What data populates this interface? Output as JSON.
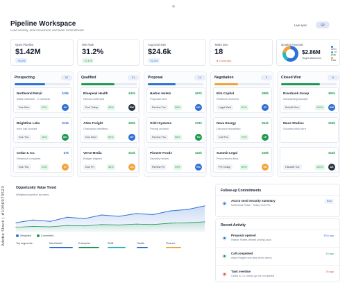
{
  "watermark": "Adobe Stock | #1956973523",
  "header": {
    "title": "Pipeline Workspace",
    "subtitle": "Lead velocity, deal movement, and team commitments",
    "live_label": "Live sync",
    "toggle_label": "Q2"
  },
  "kpis": [
    {
      "label": "Open Pipeline",
      "value": "$1.42M",
      "change": "+8.4%"
    },
    {
      "label": "Win Rate",
      "value": "31.2%",
      "change": "+2.1%"
    },
    {
      "label": "Avg Deal Size",
      "value": "$24.6k",
      "change": "+6.3%"
    },
    {
      "label": "Tasks Due",
      "value": "18",
      "change": "4 overdue"
    }
  ],
  "forecast": {
    "label": "Quarter Forecast",
    "value": "$2.86M",
    "target": "Target attainment",
    "legend": [
      "Won",
      "In play",
      "Risk"
    ],
    "colors": [
      "#2f6fd6",
      "#25b6c9",
      "#f2a33a"
    ]
  },
  "columns": [
    {
      "name": "Prospecting",
      "count": "52",
      "color": "#2f6fd6",
      "fill": 0.55,
      "cards": [
        {
          "name": "Northwind Retail",
          "amount": "$18k",
          "note": "Initial outreach · 2 contacts",
          "due": "Due Mon",
          "prob": "22%",
          "initials": "AV",
          "avatar": "#2f6fd6"
        },
        {
          "name": "Brightline Labs",
          "amount": "$11k",
          "note": "Intro call booked",
          "due": "Due Thu",
          "prob": "18%",
          "initials": "MK",
          "avatar": "#1e9a50"
        },
        {
          "name": "Cedar & Co.",
          "amount": "$7k",
          "note": "Research complete",
          "due": "Due Thu",
          "prob": "14%",
          "initials": "JT",
          "avatar": "#f2a33a"
        }
      ]
    },
    {
      "name": "Qualified",
      "count": "21",
      "color": "#1e9a50",
      "fill": 0.6,
      "cards": [
        {
          "name": "Bluepeak Health",
          "amount": "$42k",
          "note": "Needs confirmed",
          "due": "Due Today",
          "prob": "48%",
          "initials": "RW",
          "avatar": "#2a3344"
        },
        {
          "name": "Atlas Freight",
          "amount": "$29k",
          "note": "Champion identified",
          "due": "Due Wed",
          "prob": "52%",
          "initials": "DP",
          "avatar": "#2f6fd6"
        },
        {
          "name": "Verve Media",
          "amount": "$16k",
          "note": "Budget aligned",
          "due": "Due Fri",
          "prob": "45%",
          "initials": "CG",
          "avatar": "#f2a33a"
        }
      ]
    },
    {
      "name": "Proposal",
      "count": "14",
      "color": "#2f6fd6",
      "fill": 0.5,
      "cards": [
        {
          "name": "Harbor Hotels",
          "amount": "$67k",
          "note": "Proposal sent",
          "due": "Review Tue",
          "prob": "68%",
          "initials": "NO",
          "avatar": "#2f6fd6"
        },
        {
          "name": "Orbit Systems",
          "amount": "$31k",
          "note": "Pricing revision",
          "due": "Review Thu",
          "prob": "56%",
          "initials": "TW",
          "avatar": "#1e9a50"
        },
        {
          "name": "Pioneer Foods",
          "amount": "$22k",
          "note": "Security review",
          "due": "Review Fri",
          "prob": "49%",
          "initials": "EM",
          "avatar": "#2f6fd6"
        }
      ]
    },
    {
      "name": "Negotiation",
      "count": "9",
      "color": "#f2a33a",
      "fill": 0.42,
      "cards": [
        {
          "name": "Elm Capital",
          "amount": "$88k",
          "note": "Redlines received",
          "due": "Legal Wed",
          "prob": "81%",
          "initials": "IR",
          "avatar": "#2f6fd6"
        },
        {
          "name": "Nova Energy",
          "amount": "$54k",
          "note": "Discount requested",
          "due": "Call Thu",
          "prob": "74%",
          "initials": "LP",
          "avatar": "#1e9a50"
        },
        {
          "name": "Summit Legal",
          "amount": "$36k",
          "note": "Procurement final",
          "due": "PO Today",
          "prob": "69%",
          "initials": "SN",
          "avatar": "#f2a33a"
        }
      ]
    },
    {
      "name": "Closed Won",
      "count": "6",
      "color": "#1e9a50",
      "fill": 0.7,
      "cards": [
        {
          "name": "Riverbank Group",
          "amount": "$92k",
          "note": "Onboarding handoff",
          "due": "Kickoff Mon",
          "prob": "100%",
          "initials": "AW",
          "avatar": "#2f6fd6"
        },
        {
          "name": "Muse Studios",
          "amount": "$18k",
          "note": "Success intro sent",
          "due": "",
          "prob": "",
          "initials": "",
          "avatar": "#1e9a50"
        },
        {
          "name": "",
          "amount": "$16k",
          "note": "",
          "due": "Handoff Tue",
          "prob": "100%",
          "initials": "AS",
          "avatar": "#2a3344"
        }
      ]
    }
  ],
  "trend": {
    "title": "Opportunity Value Trend",
    "subtitle": "Weighted pipeline by week",
    "legend": [
      "Weighted",
      "Committed"
    ],
    "segments_label": "Top segments",
    "segments": [
      {
        "name": "Mid-Market",
        "color": "#2f6fd6"
      },
      {
        "name": "Enterprise",
        "color": "#1e9a50"
      },
      {
        "name": "SMB",
        "color": "#25b6c9"
      },
      {
        "name": "Health",
        "color": "#2f6fd6"
      },
      {
        "name": "Finance",
        "color": "#f2a33a"
      }
    ]
  },
  "chart_data": {
    "type": "area",
    "x": [
      1,
      2,
      3,
      4,
      5,
      6,
      7,
      8,
      9,
      10,
      11,
      12
    ],
    "series": [
      {
        "name": "Weighted",
        "values": [
          18,
          24,
          21,
          30,
          27,
          35,
          32,
          38,
          36,
          44,
          47,
          55
        ],
        "color": "#2f6fd6"
      },
      {
        "name": "Committed",
        "values": [
          8,
          10,
          9,
          12,
          11,
          14,
          13,
          15,
          14,
          17,
          18,
          20
        ],
        "color": "#1e9a50"
      }
    ],
    "ylim": [
      0,
      70
    ],
    "title": "Opportunity Value Trend",
    "grid": false
  },
  "commitments": {
    "title": "Follow-up Commitments",
    "items": [
      {
        "title": "Ava to send security summary",
        "sub": "Northwind Retail · Today 3:00 PM",
        "chip": "Now"
      }
    ]
  },
  "activity": {
    "title": "Recent Activity",
    "items": [
      {
        "title": "Proposal opened",
        "sub": "Harbor Hotels viewed pricing pack",
        "time": "32m ago",
        "color": "#2f6fd6"
      },
      {
        "title": "Call completed",
        "sub": "Atlas Freight next step set to demo",
        "time": "1h ago",
        "color": "#1e9a50"
      },
      {
        "title": "Task overdue",
        "sub": "Cedar & Co. follow-up not completed",
        "time": "2h ago",
        "color": "#d9503a"
      }
    ]
  }
}
